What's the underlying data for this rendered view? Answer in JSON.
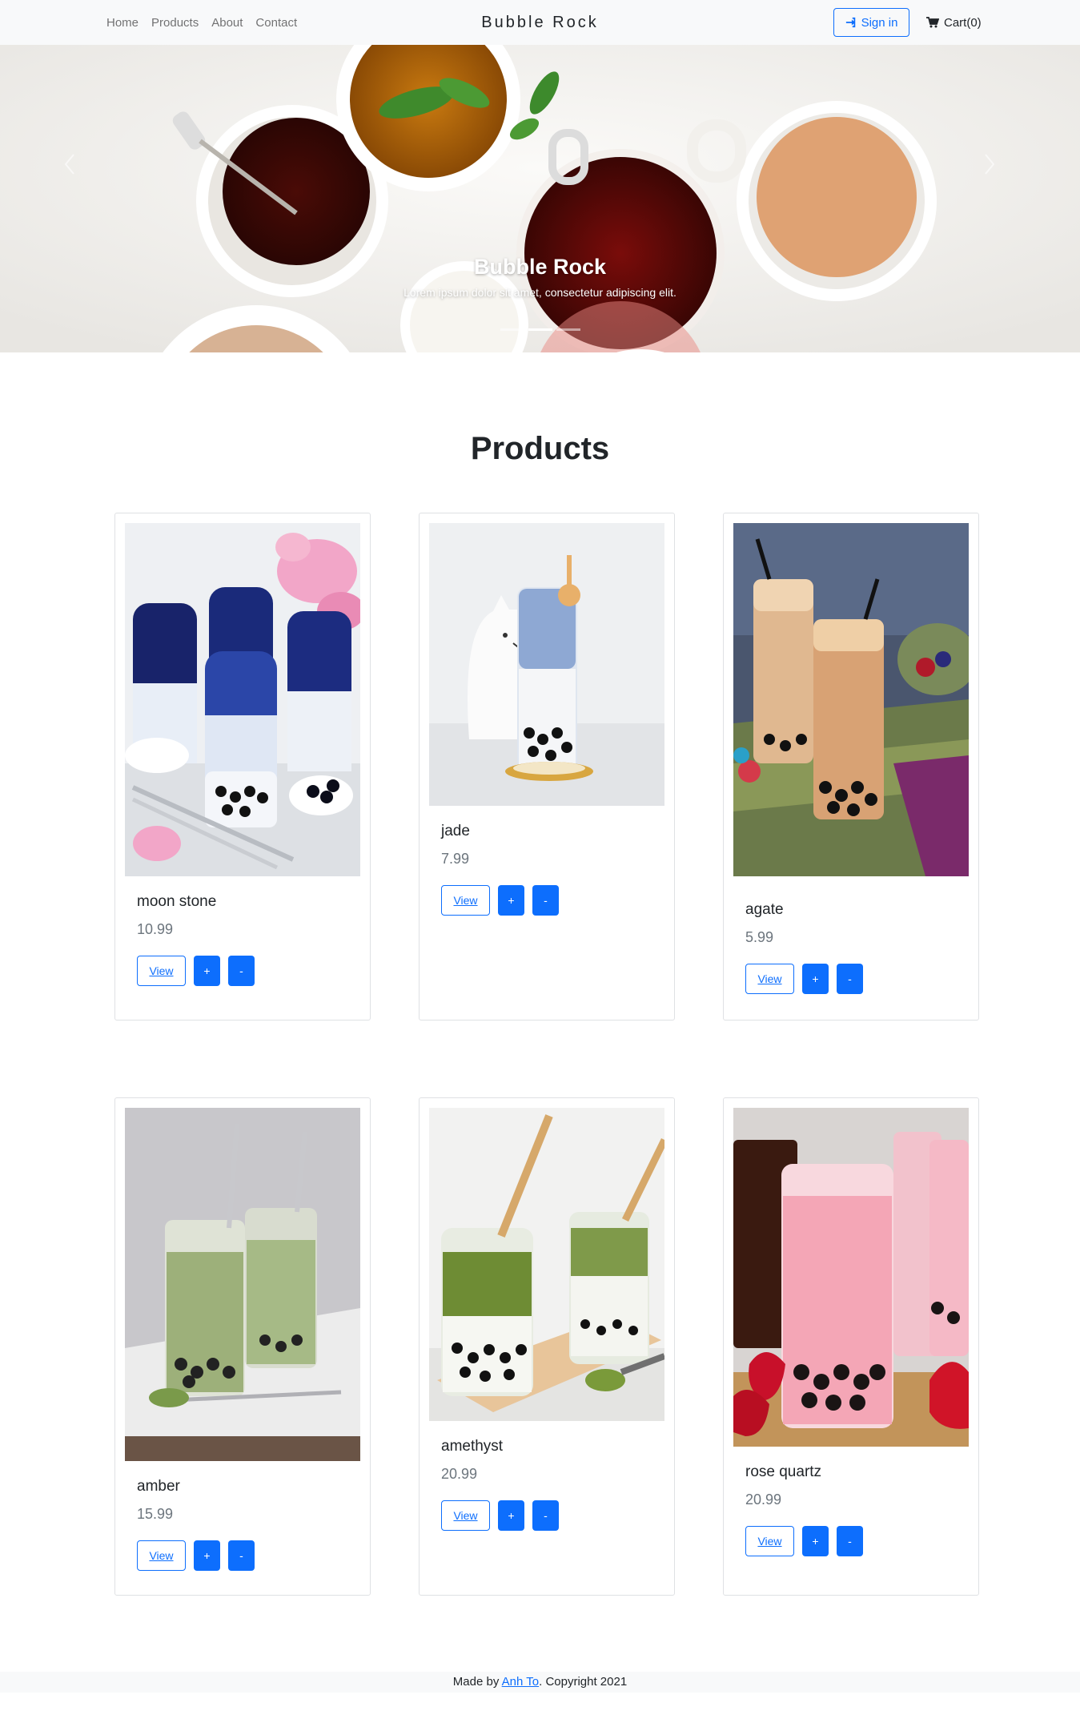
{
  "navbar": {
    "links": [
      "Home",
      "Products",
      "About",
      "Contact"
    ],
    "brand": "Bubble Rock",
    "signin_label": "Sign in",
    "cart_label": "Cart(0)"
  },
  "hero": {
    "caption_title": "Bubble Rock",
    "caption_text": "Lorem ipsum dolor sit amet, consectetur adipiscing elit.",
    "slide_count": 3,
    "active_slide": 2
  },
  "products": {
    "title": "Products",
    "view_label": "View",
    "plus_label": "+",
    "minus_label": "-",
    "items": [
      {
        "name": "moon stone",
        "price": "10.99"
      },
      {
        "name": "jade",
        "price": "7.99"
      },
      {
        "name": "agate",
        "price": "5.99"
      },
      {
        "name": "amber",
        "price": "15.99"
      },
      {
        "name": "amethyst",
        "price": "20.99"
      },
      {
        "name": "rose quartz",
        "price": "20.99"
      }
    ]
  },
  "footer": {
    "prefix": "Made by ",
    "author": "Anh To",
    "suffix": ". Copyright 2021"
  },
  "colors": {
    "accent": "#0d6efd",
    "navbar_bg": "#f8f9fa",
    "price_text": "#6c757d"
  }
}
